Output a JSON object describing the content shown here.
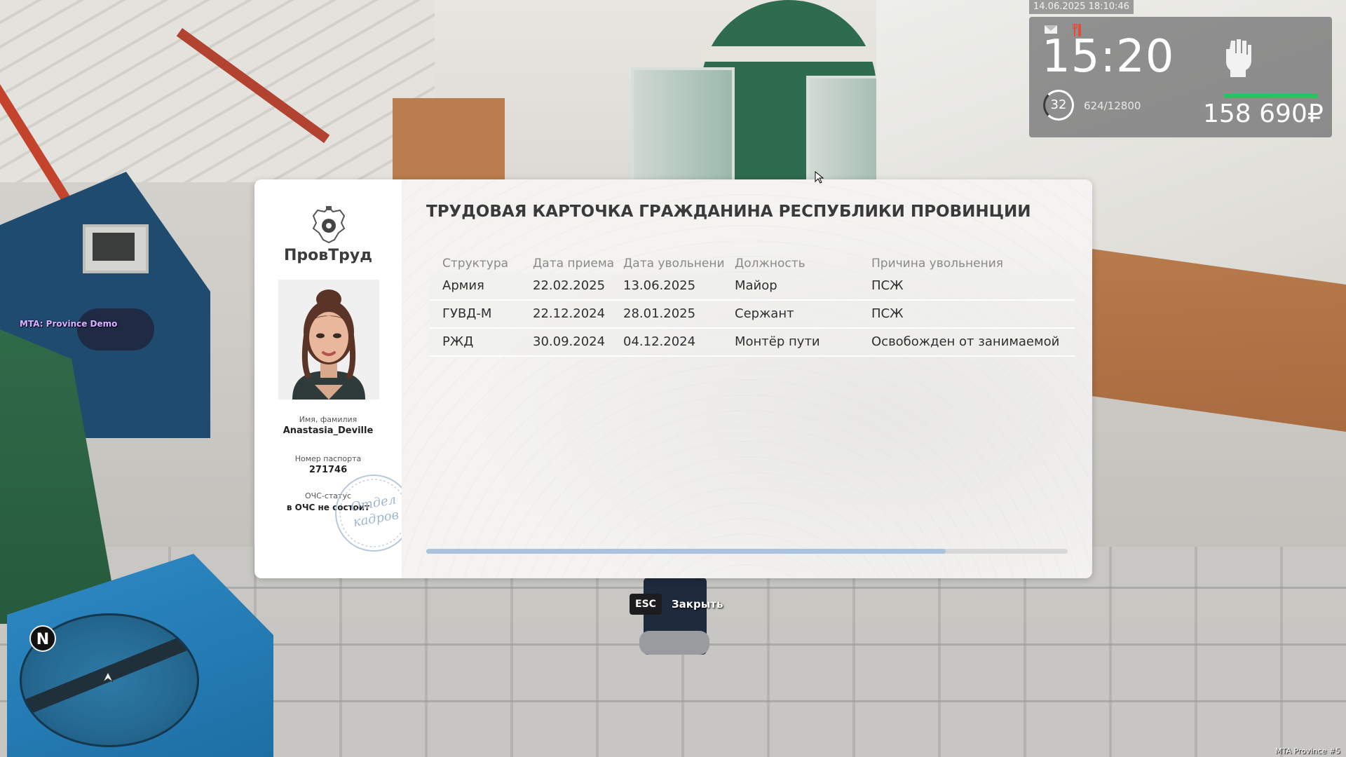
{
  "server_label": "MTA: Province Demo",
  "corner_label": "MTA Province #5",
  "hud": {
    "datetime": "14.06.2025 18:10:46",
    "time": "15:20",
    "level": "32",
    "xp": "624/12800",
    "money": "158 690₽",
    "icons": [
      "mail-icon",
      "hunger-icon",
      "fist-icon"
    ],
    "accent_green": "#22c55e"
  },
  "card": {
    "org_name": "ПровТруд",
    "title": "ТРУДОВАЯ КАРТОЧКА ГРАЖДАНИНА РЕСПУБЛИКИ ПРОВИНЦИИ",
    "name_label": "Имя, фамилия",
    "name_value": "Anastasia_Deville",
    "passport_label": "Номер паспорта",
    "passport_value": "271746",
    "ochs_label": "ОЧС-статус",
    "ochs_value": "в ОЧС не состоит",
    "stamp_lines": [
      "Отдел",
      "кадров"
    ],
    "columns": [
      "Структура",
      "Дата приема",
      "Дата увольнени",
      "Должность",
      "Причина увольнения"
    ],
    "rows": [
      [
        "Армия",
        "22.02.2025",
        "13.06.2025",
        "Майор",
        "ПСЖ"
      ],
      [
        "ГУВД-М",
        "22.12.2024",
        "28.01.2025",
        "Сержант",
        "ПСЖ"
      ],
      [
        "РЖД",
        "30.09.2024",
        "04.12.2024",
        "Монтёр пути",
        "Освобожден от занимаемой"
      ]
    ],
    "scroll_fraction": 0.81
  },
  "hint": {
    "key": "ESC",
    "label": "Закрыть"
  },
  "minimap": {
    "north": "N"
  }
}
